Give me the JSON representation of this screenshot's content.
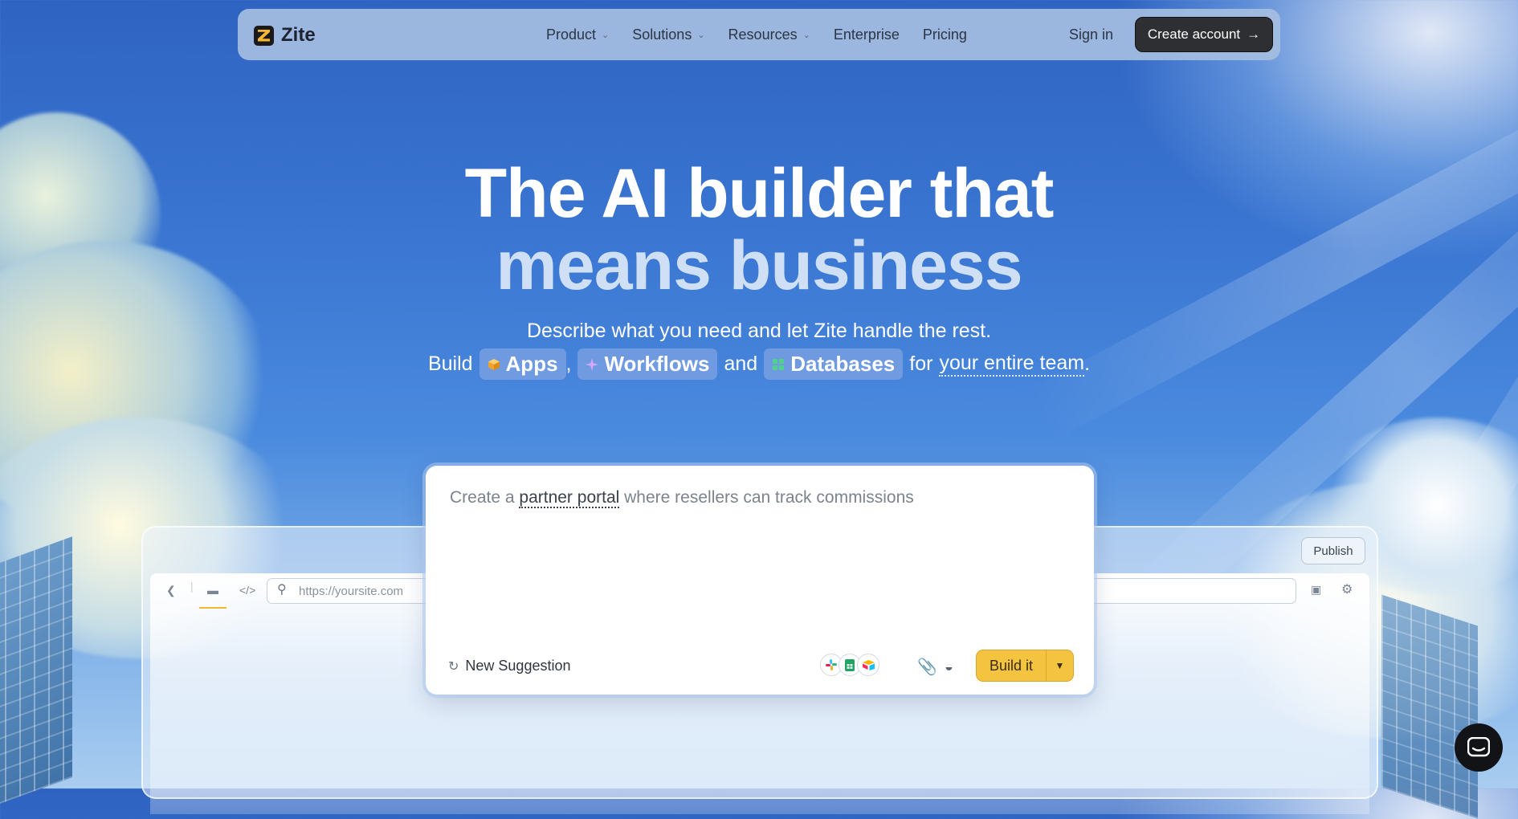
{
  "nav": {
    "brand": "Zite",
    "links": [
      {
        "label": "Product",
        "has_dropdown": true
      },
      {
        "label": "Solutions",
        "has_dropdown": true
      },
      {
        "label": "Resources",
        "has_dropdown": true
      },
      {
        "label": "Enterprise",
        "has_dropdown": false
      },
      {
        "label": "Pricing",
        "has_dropdown": false
      }
    ],
    "signin": "Sign in",
    "create_account": "Create account",
    "create_account_icon": "arrow-right-icon"
  },
  "hero": {
    "title_line1": "The AI builder that",
    "title_line2": "means business",
    "subtitle": "Describe what you need and let Zite handle the rest.",
    "build_prefix": "Build",
    "pill_apps": "Apps",
    "comma": ",",
    "pill_workflows": "Workflows",
    "and": "and",
    "pill_databases": "Databases",
    "for": "for",
    "team": "your entire team",
    "period": "."
  },
  "prompt": {
    "text_before": "Create a",
    "text_highlight": "partner portal",
    "text_after": "where resellers can track commissions",
    "new_suggestion": "New Suggestion",
    "integrations": [
      "slack-icon",
      "google-sheets-icon",
      "airtable-icon"
    ],
    "build_label": "Build it"
  },
  "preview": {
    "publish": "Publish",
    "url_placeholder": "https://yoursite.com"
  },
  "colors": {
    "accent": "#f4c441",
    "nav_bg": "#a5bee1",
    "dark_button": "#2d2f33"
  }
}
